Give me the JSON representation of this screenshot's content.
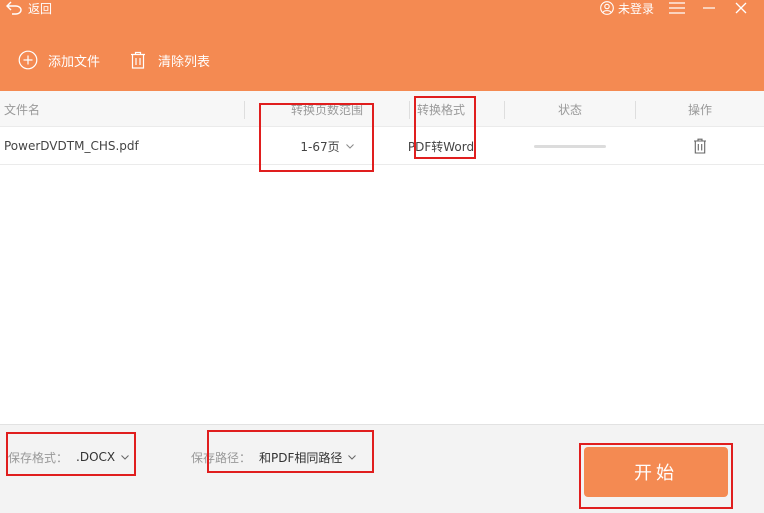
{
  "header": {
    "back_label": "返回",
    "login_label": "未登录",
    "toolbar": {
      "add_label": "添加文件",
      "clear_label": "清除列表"
    }
  },
  "table": {
    "columns": [
      "文件名",
      "转换页数范围",
      "转换格式",
      "状态",
      "操作"
    ],
    "rows": [
      {
        "filename": "PowerDVDTM_CHS.pdf",
        "page_range": "1-67页",
        "format": "PDF转Word",
        "status_progress": 0
      }
    ]
  },
  "footer": {
    "save_format_label": "保存格式：",
    "save_format_value": ".DOCX",
    "save_path_label": "保存路径：",
    "save_path_value": "和PDF相同路径",
    "start_label": "开始"
  },
  "colors": {
    "accent": "#f48a52",
    "annotation": "#e01e1e"
  }
}
